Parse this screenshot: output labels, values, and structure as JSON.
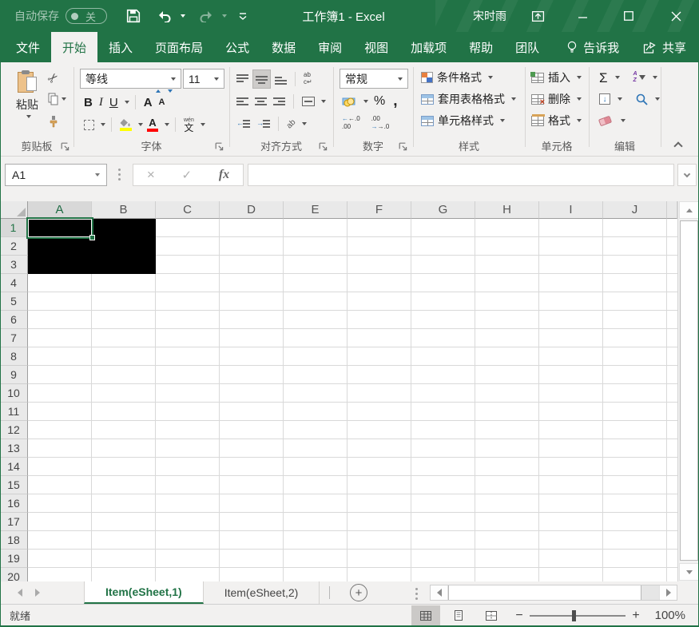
{
  "colors": {
    "excel_green": "#217346",
    "ribbon_bg": "#f2f1f0",
    "grid_line": "#d9d9d9",
    "highlight_yellow": "#ffff00",
    "font_color_red": "#ff0000"
  },
  "titlebar": {
    "autosave_label": "自动保存",
    "autosave_state": "关",
    "title": "工作簿1 - Excel",
    "user_name": "宋时雨"
  },
  "ribbon_tabs": {
    "file": "文件",
    "active": "开始",
    "items": [
      "开始",
      "插入",
      "页面布局",
      "公式",
      "数据",
      "审阅",
      "视图",
      "加载项",
      "帮助",
      "团队"
    ],
    "tell_me": "告诉我",
    "share": "共享"
  },
  "ribbon": {
    "clipboard": {
      "label": "剪贴板",
      "paste": "粘贴"
    },
    "font": {
      "label": "字体",
      "font_name": "等线",
      "font_size": "11",
      "bold": "B",
      "italic": "I",
      "underline": "U",
      "grow": "A",
      "shrink": "A",
      "pinyin_annotation": "wén",
      "pinyin_char": "文"
    },
    "alignment": {
      "label": "对齐方式",
      "wrap_line1": "ab",
      "wrap_line2": "c↵",
      "orientation": "ab"
    },
    "number": {
      "label": "数字",
      "format": "常规",
      "percent": "%",
      "comma": ",",
      "inc_decimal_top": "←.0",
      "inc_decimal_bottom": ".00",
      "dec_decimal_top": ".00",
      "dec_decimal_bottom": "→.0"
    },
    "styles": {
      "label": "样式",
      "conditional_formatting": "条件格式",
      "format_as_table": "套用表格格式",
      "cell_styles": "单元格样式"
    },
    "cells": {
      "label": "单元格",
      "insert": "插入",
      "delete": "删除",
      "format": "格式"
    },
    "editing": {
      "label": "编辑",
      "autosum": "Σ",
      "sort_a": "A",
      "sort_z": "Z"
    }
  },
  "formula_bar": {
    "name_box": "A1",
    "cancel": "×",
    "enter": "✓",
    "insert_function": "fx",
    "value": ""
  },
  "grid": {
    "columns": [
      "A",
      "B",
      "C",
      "D",
      "E",
      "F",
      "G",
      "H",
      "I",
      "J"
    ],
    "selected_column": "A",
    "selected_row": 1,
    "row_count": 20
  },
  "sheet_bar": {
    "tabs": [
      {
        "label": "Item(eSheet,1)",
        "active": true
      },
      {
        "label": "Item(eSheet,2)",
        "active": false
      }
    ]
  },
  "status_bar": {
    "mode": "就绪",
    "zoom_out": "−",
    "zoom_in": "+",
    "zoom_level": "100%",
    "new_sheet": "+"
  }
}
